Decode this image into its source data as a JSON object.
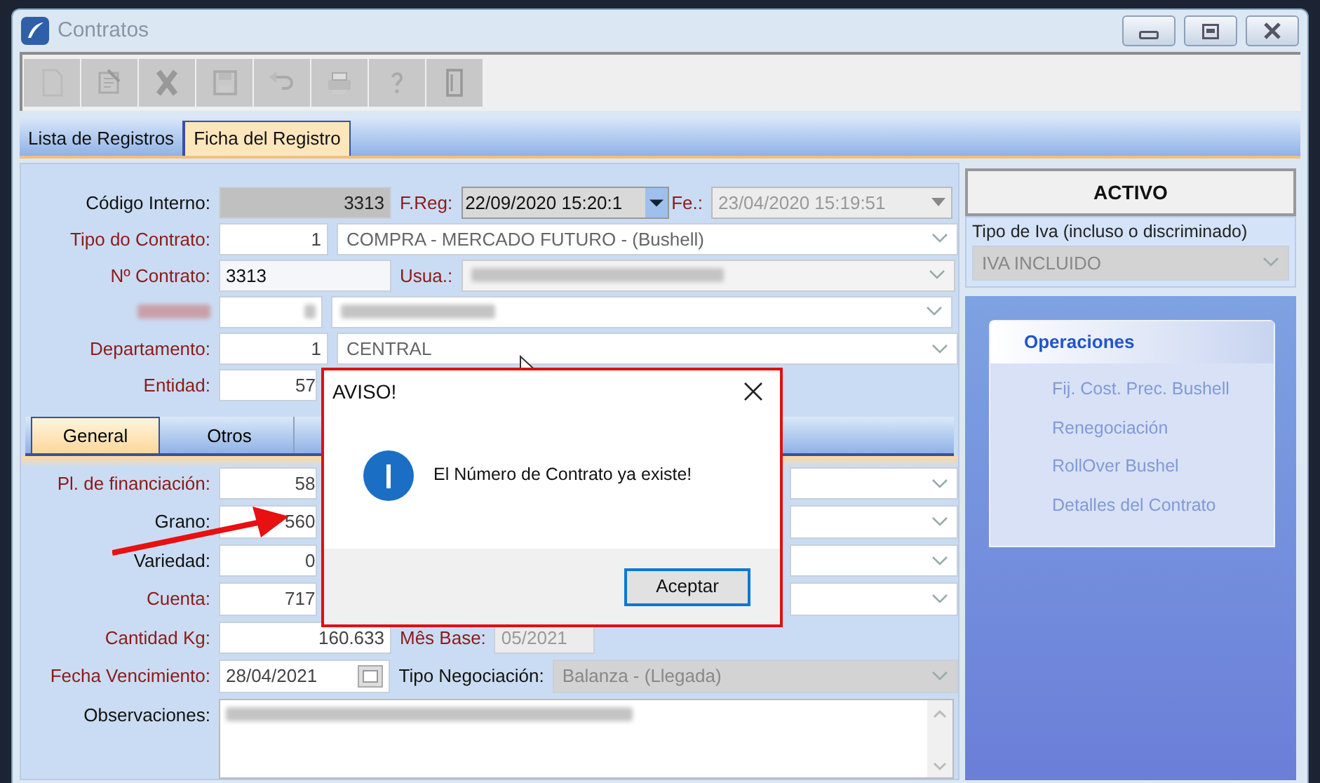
{
  "window": {
    "title": "Contratos"
  },
  "tabs": [
    {
      "label": "Lista de Registros",
      "selected": false
    },
    {
      "label": "Ficha del Registro",
      "selected": true
    }
  ],
  "codigo_interno": {
    "label": "Código Interno:",
    "value": "3313",
    "required": false
  },
  "f_reg": {
    "label": "F.Reg:",
    "value": "22/09/2020 15:20:1",
    "required": true
  },
  "fe": {
    "label": "Fe.:",
    "value": "23/04/2020 15:19:51",
    "required": true,
    "disabled": true
  },
  "tipo_contrato": {
    "label": "Tipo do Contrato:",
    "code": "1",
    "value": "COMPRA - MERCADO FUTURO - (Bushell)",
    "required": true
  },
  "n_contrato": {
    "label": "Nº Contrato:",
    "value": "3313",
    "required": true
  },
  "usua": {
    "label": "Usua.:",
    "required": true
  },
  "departamento": {
    "label": "Departamento:",
    "code": "1",
    "value": "CENTRAL",
    "required": true
  },
  "entidad": {
    "label": "Entidad:",
    "code": "57",
    "required": true
  },
  "status": "ACTIVO",
  "iva": {
    "label": "Tipo de Iva (incluso o discriminado)",
    "value": "IVA INCLUIDO"
  },
  "operaciones": {
    "title": "Operaciones",
    "items": [
      {
        "label": "Fij. Cost. Prec. Bushell",
        "disabled": true
      },
      {
        "label": "Renegociación",
        "disabled": true
      },
      {
        "label": "RollOver Bushel",
        "disabled": true
      },
      {
        "label": "Detalles del Contrato",
        "disabled": true
      }
    ]
  },
  "subtabs": [
    {
      "label": "General",
      "selected": true
    },
    {
      "label": "Otros",
      "selected": false
    }
  ],
  "fields": [
    {
      "label": "Pl. de financiación:",
      "value": "58",
      "required": true
    },
    {
      "label": "Grano:",
      "value": "560",
      "required": false
    },
    {
      "label": "Variedad:",
      "value": "0",
      "required": false
    },
    {
      "label": "Cuenta:",
      "value": "717",
      "required": true
    }
  ],
  "cantidad": {
    "label": "Cantidad Kg:",
    "value": "160.633",
    "required": true
  },
  "mes_base": {
    "label": "Mês Base:",
    "value": "05/2021",
    "required": true,
    "disabled": true
  },
  "vencimiento": {
    "label": "Fecha Vencimiento:",
    "value": "28/04/2021",
    "required": true
  },
  "tipo_negociacion": {
    "label": "Tipo Negociación:",
    "value": "Balanza - (Llegada)",
    "required": false
  },
  "observaciones": {
    "label": "Observaciones:",
    "required": false
  },
  "dialog": {
    "title": "AVISO!",
    "message": "El Número de Contrato ya existe!",
    "button": "Aceptar"
  }
}
